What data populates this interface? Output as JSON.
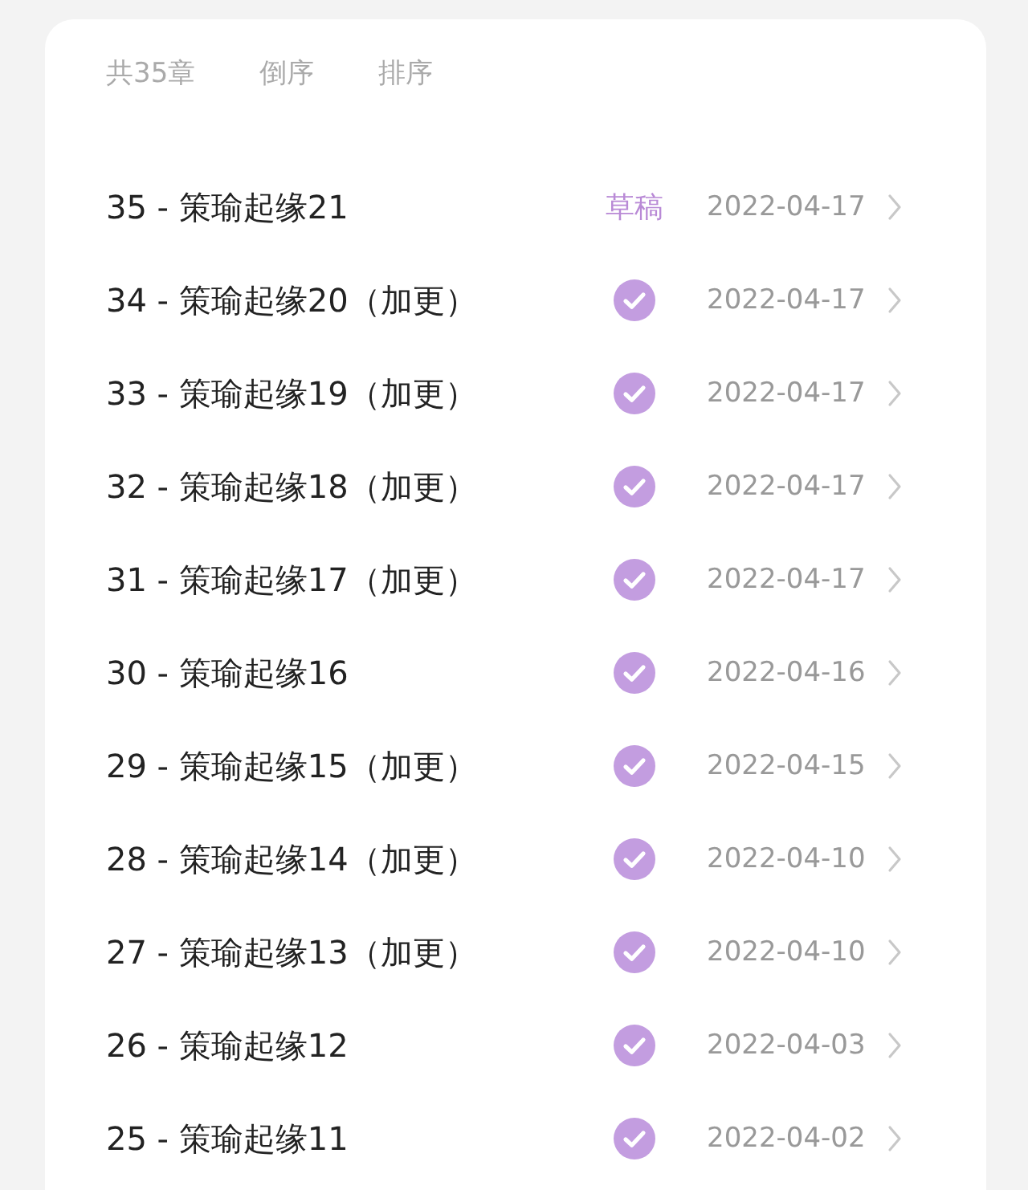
{
  "header": {
    "count": "共35章",
    "reverse": "倒序",
    "sort": "排序"
  },
  "chapters": [
    {
      "title": "35 - 策瑜起缘21",
      "status": {
        "kind": "draft",
        "label": "草稿"
      },
      "date": "2022-04-17"
    },
    {
      "title": "34 - 策瑜起缘20（加更）",
      "status": {
        "kind": "published"
      },
      "date": "2022-04-17"
    },
    {
      "title": "33 - 策瑜起缘19（加更）",
      "status": {
        "kind": "published"
      },
      "date": "2022-04-17"
    },
    {
      "title": "32 - 策瑜起缘18（加更）",
      "status": {
        "kind": "published"
      },
      "date": "2022-04-17"
    },
    {
      "title": "31 - 策瑜起缘17（加更）",
      "status": {
        "kind": "published"
      },
      "date": "2022-04-17"
    },
    {
      "title": "30 - 策瑜起缘16",
      "status": {
        "kind": "published"
      },
      "date": "2022-04-16"
    },
    {
      "title": "29 - 策瑜起缘15（加更）",
      "status": {
        "kind": "published"
      },
      "date": "2022-04-15"
    },
    {
      "title": "28 - 策瑜起缘14（加更）",
      "status": {
        "kind": "published"
      },
      "date": "2022-04-10"
    },
    {
      "title": "27 - 策瑜起缘13（加更）",
      "status": {
        "kind": "published"
      },
      "date": "2022-04-10"
    },
    {
      "title": "26 - 策瑜起缘12",
      "status": {
        "kind": "published"
      },
      "date": "2022-04-03"
    },
    {
      "title": "25 - 策瑜起缘11",
      "status": {
        "kind": "published"
      },
      "date": "2022-04-02"
    }
  ]
}
